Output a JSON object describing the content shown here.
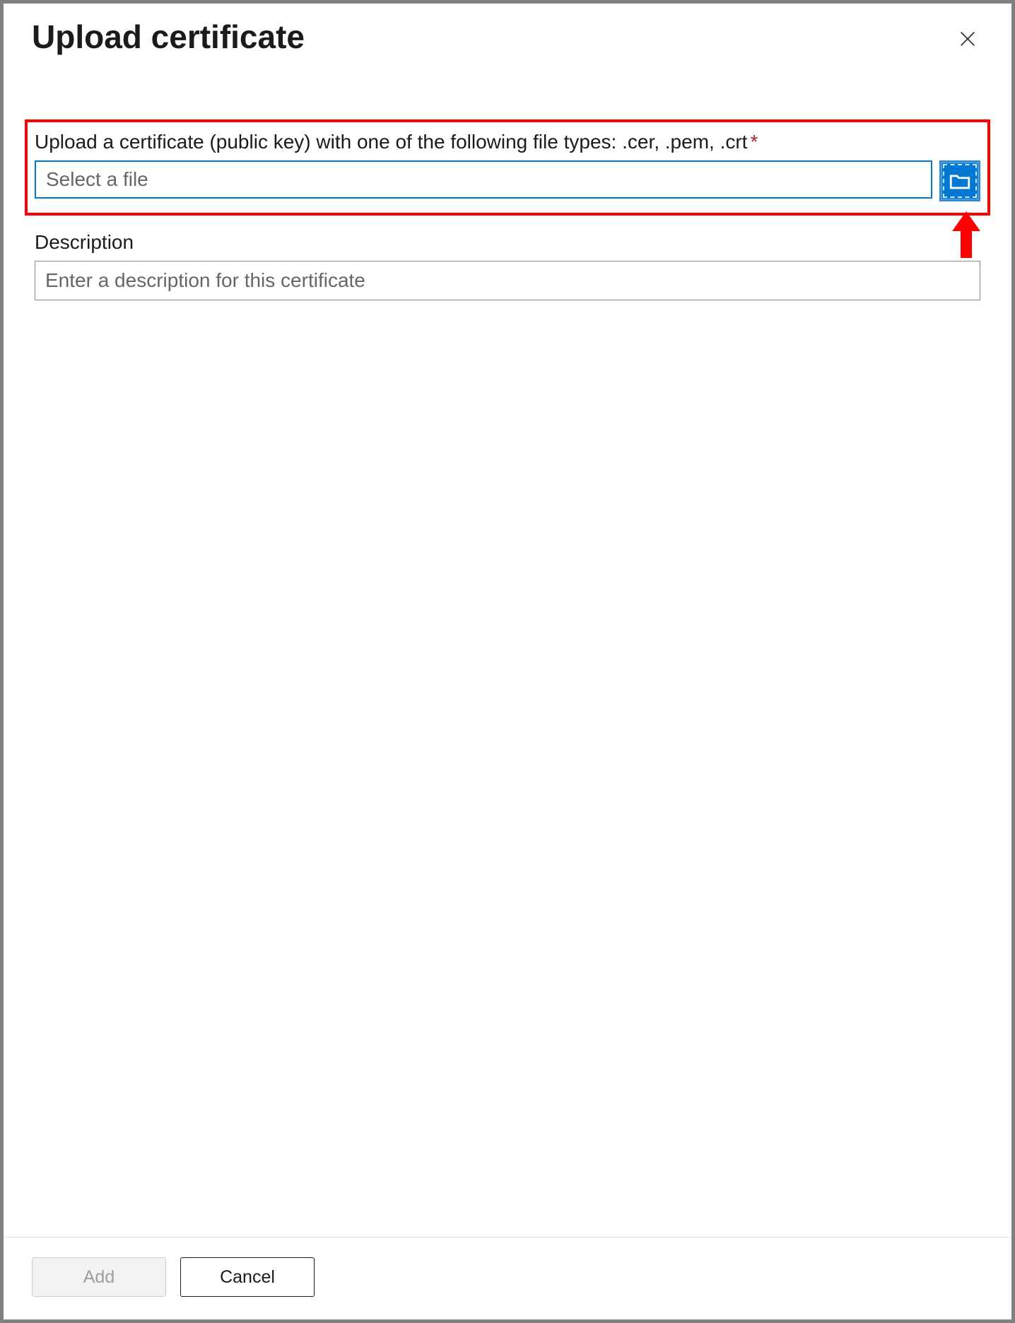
{
  "dialog": {
    "title": "Upload certificate"
  },
  "form": {
    "file_label": "Upload a certificate (public key) with one of the following file types: .cer, .pem, .crt",
    "file_placeholder": "Select a file",
    "description_label": "Description",
    "description_placeholder": "Enter a description for this certificate"
  },
  "footer": {
    "add_label": "Add",
    "cancel_label": "Cancel"
  }
}
